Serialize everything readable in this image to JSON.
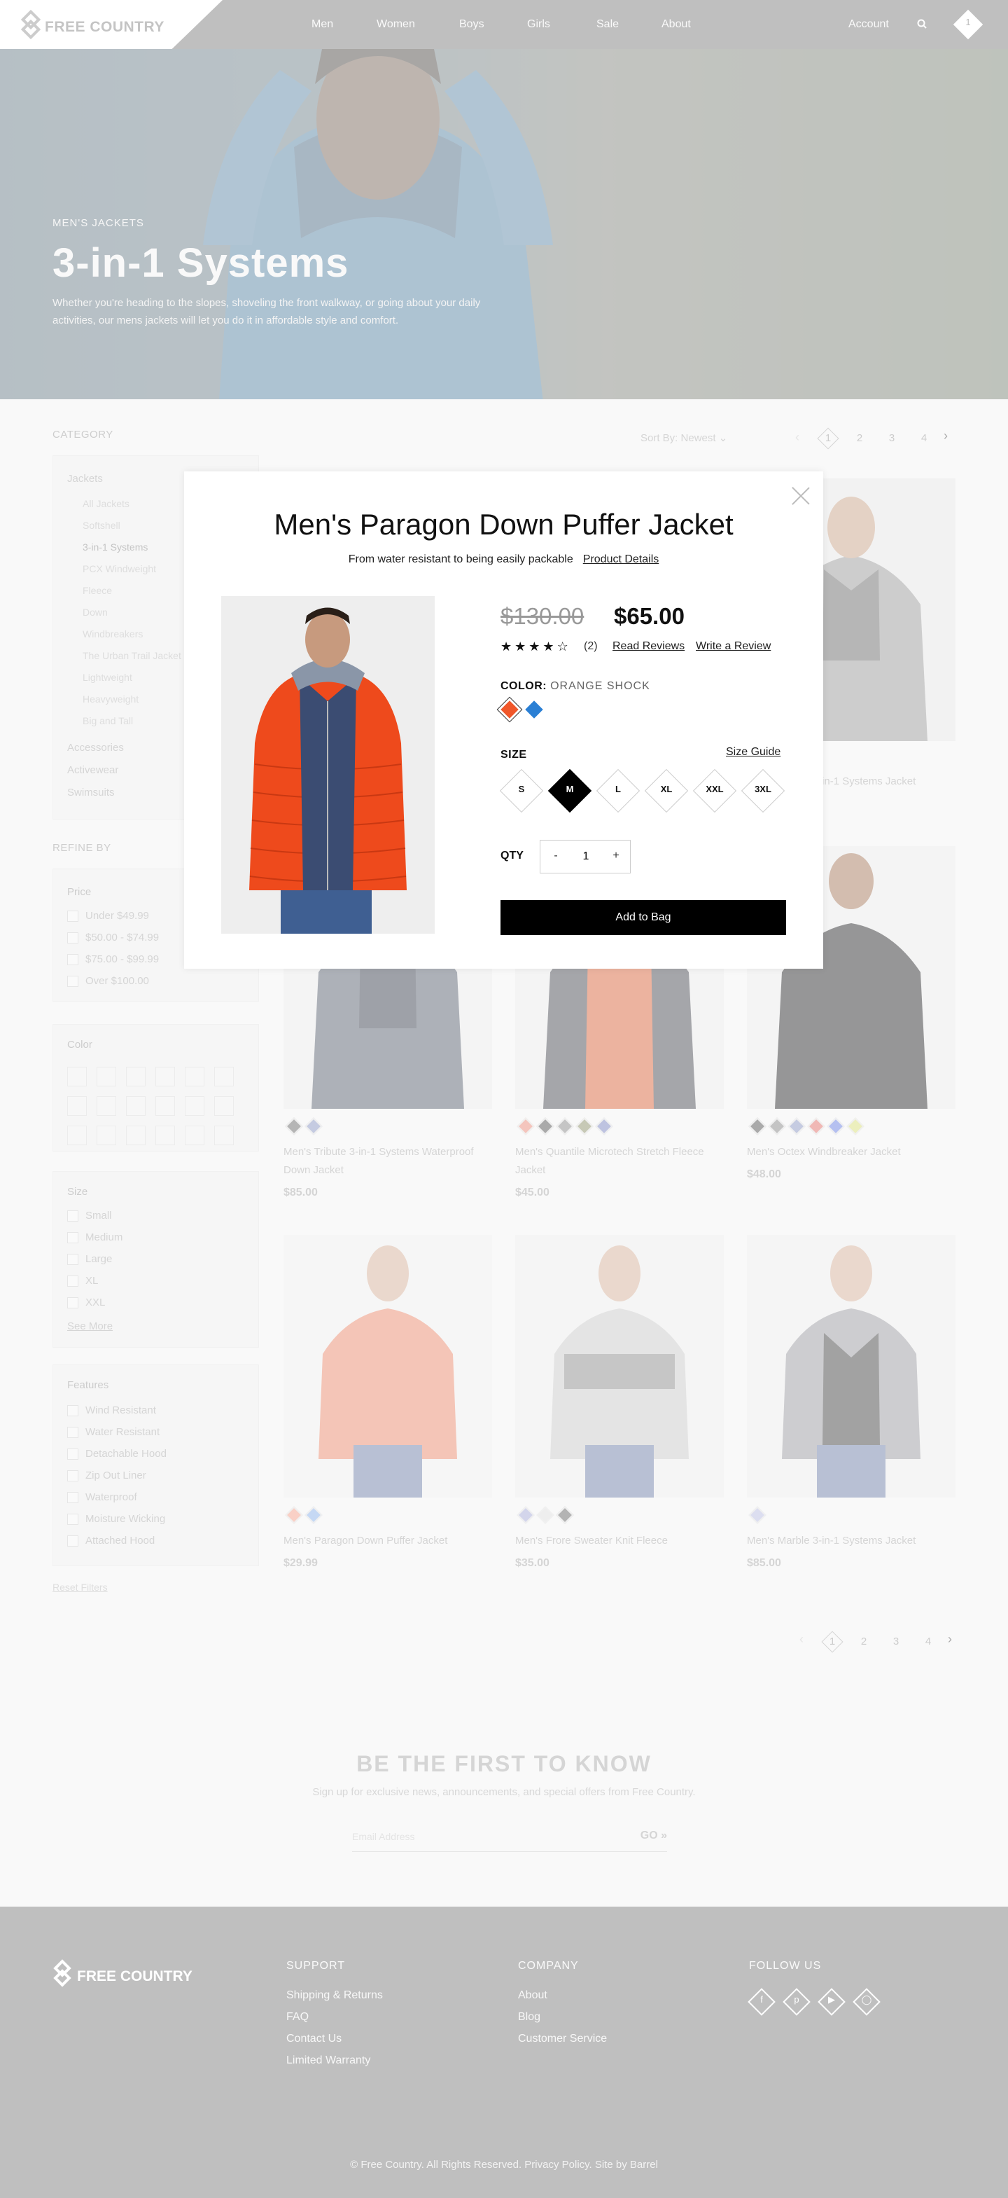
{
  "header": {
    "logo_text": "FREE COUNTRY",
    "nav": [
      "Men",
      "Women",
      "Boys",
      "Girls",
      "Sale",
      "About"
    ],
    "account": "Account",
    "bag_count": "1"
  },
  "hero": {
    "eyebrow": "MEN'S JACKETS",
    "title": "3-in-1 Systems",
    "description": "Whether you're heading to the slopes, shoveling the front walkway, or going about your daily activities, our mens jackets will let you do it in affordable style and comfort."
  },
  "sidebar": {
    "category_title": "CATEGORY",
    "categories": {
      "jackets": "Jackets",
      "jacket_subs": [
        "All Jackets",
        "Softshell",
        "3-in-1 Systems",
        "PCX Windweight",
        "Fleece",
        "Down",
        "Windbreakers",
        "The Urban Trail Jacket",
        "Lightweight",
        "Heavyweight",
        "Big and Tall"
      ],
      "others": [
        "Accessories",
        "Activewear",
        "Swimsuits"
      ]
    },
    "refine_title": "REFINE BY",
    "price": {
      "title": "Price",
      "options": [
        "Under $49.99",
        "$50.00 - $74.99",
        "$75.00 - $99.99",
        "Over $100.00"
      ]
    },
    "color": {
      "title": "Color"
    },
    "size": {
      "title": "Size",
      "options": [
        "Small",
        "Medium",
        "Large",
        "XL",
        "XXL"
      ],
      "see_more": "See More"
    },
    "features": {
      "title": "Features",
      "options": [
        "Wind Resistant",
        "Water Resistant",
        "Detachable Hood",
        "Zip Out Liner",
        "Waterproof",
        "Moisture Wicking",
        "Attached Hood"
      ]
    },
    "reset": "Reset Filters"
  },
  "listing": {
    "sort_label": "Sort By: Newest",
    "pages": [
      "1",
      "2",
      "3",
      "4"
    ]
  },
  "products": [
    {
      "name": "Men's Tribute 3-in-1 Systems Jacket",
      "price": ""
    },
    {
      "name": "Men's Tribute 3-in-1 Systems Waterproof Down Jacket",
      "price": "$85.00"
    },
    {
      "name": "Men's Quantile Microtech Stretch Fleece Jacket",
      "price": "$45.00"
    },
    {
      "name": "Men's Octex Windbreaker Jacket",
      "price": "$48.00"
    },
    {
      "name": "Men's Paragon Down Puffer Jacket",
      "price": "$29.99"
    },
    {
      "name": "Men's Frore Sweater Knit Fleece",
      "price": "$35.00"
    },
    {
      "name": "Men's Marble 3-in-1 Systems Jacket",
      "price": "$85.00"
    }
  ],
  "newsletter": {
    "title": "BE THE FIRST TO KNOW",
    "subtitle": "Sign up for exclusive news, announcements, and special offers from Free Country.",
    "placeholder": "Email Address",
    "go": "GO"
  },
  "footer": {
    "logo_text": "FREE COUNTRY",
    "support_title": "SUPPORT",
    "support_links": [
      "Shipping & Returns",
      "FAQ",
      "Contact Us",
      "Limited Warranty"
    ],
    "company_title": "COMPANY",
    "company_links": [
      "About",
      "Blog",
      "Customer Service"
    ],
    "follow_title": "FOLLOW US",
    "social_icons": [
      "facebook-icon",
      "pinterest-icon",
      "youtube-icon",
      "instagram-icon"
    ],
    "copyright": "© Free Country. All Rights Reserved. Privacy Policy. Site by Barrel"
  },
  "modal": {
    "title": "Men's Paragon Down Puffer Jacket",
    "subtitle": "From water resistant to being easily packable",
    "details_link": "Product Details",
    "price_was": "$130.00",
    "price_now": "$65.00",
    "rating": 4,
    "rating_count": "(2)",
    "read_reviews": "Read Reviews",
    "write_review": "Write a Review",
    "color_label": "COLOR:",
    "color_value": "ORANGE SHOCK",
    "colors": [
      "#f0572a",
      "#2a7fd4"
    ],
    "size_label": "SIZE",
    "size_guide": "Size Guide",
    "sizes": [
      "S",
      "M",
      "L",
      "XL",
      "XXL",
      "3XL"
    ],
    "selected_size": "M",
    "qty_label": "QTY",
    "qty_minus": "-",
    "qty_value": "1",
    "qty_plus": "+",
    "add_to_bag": "Add to Bag"
  }
}
